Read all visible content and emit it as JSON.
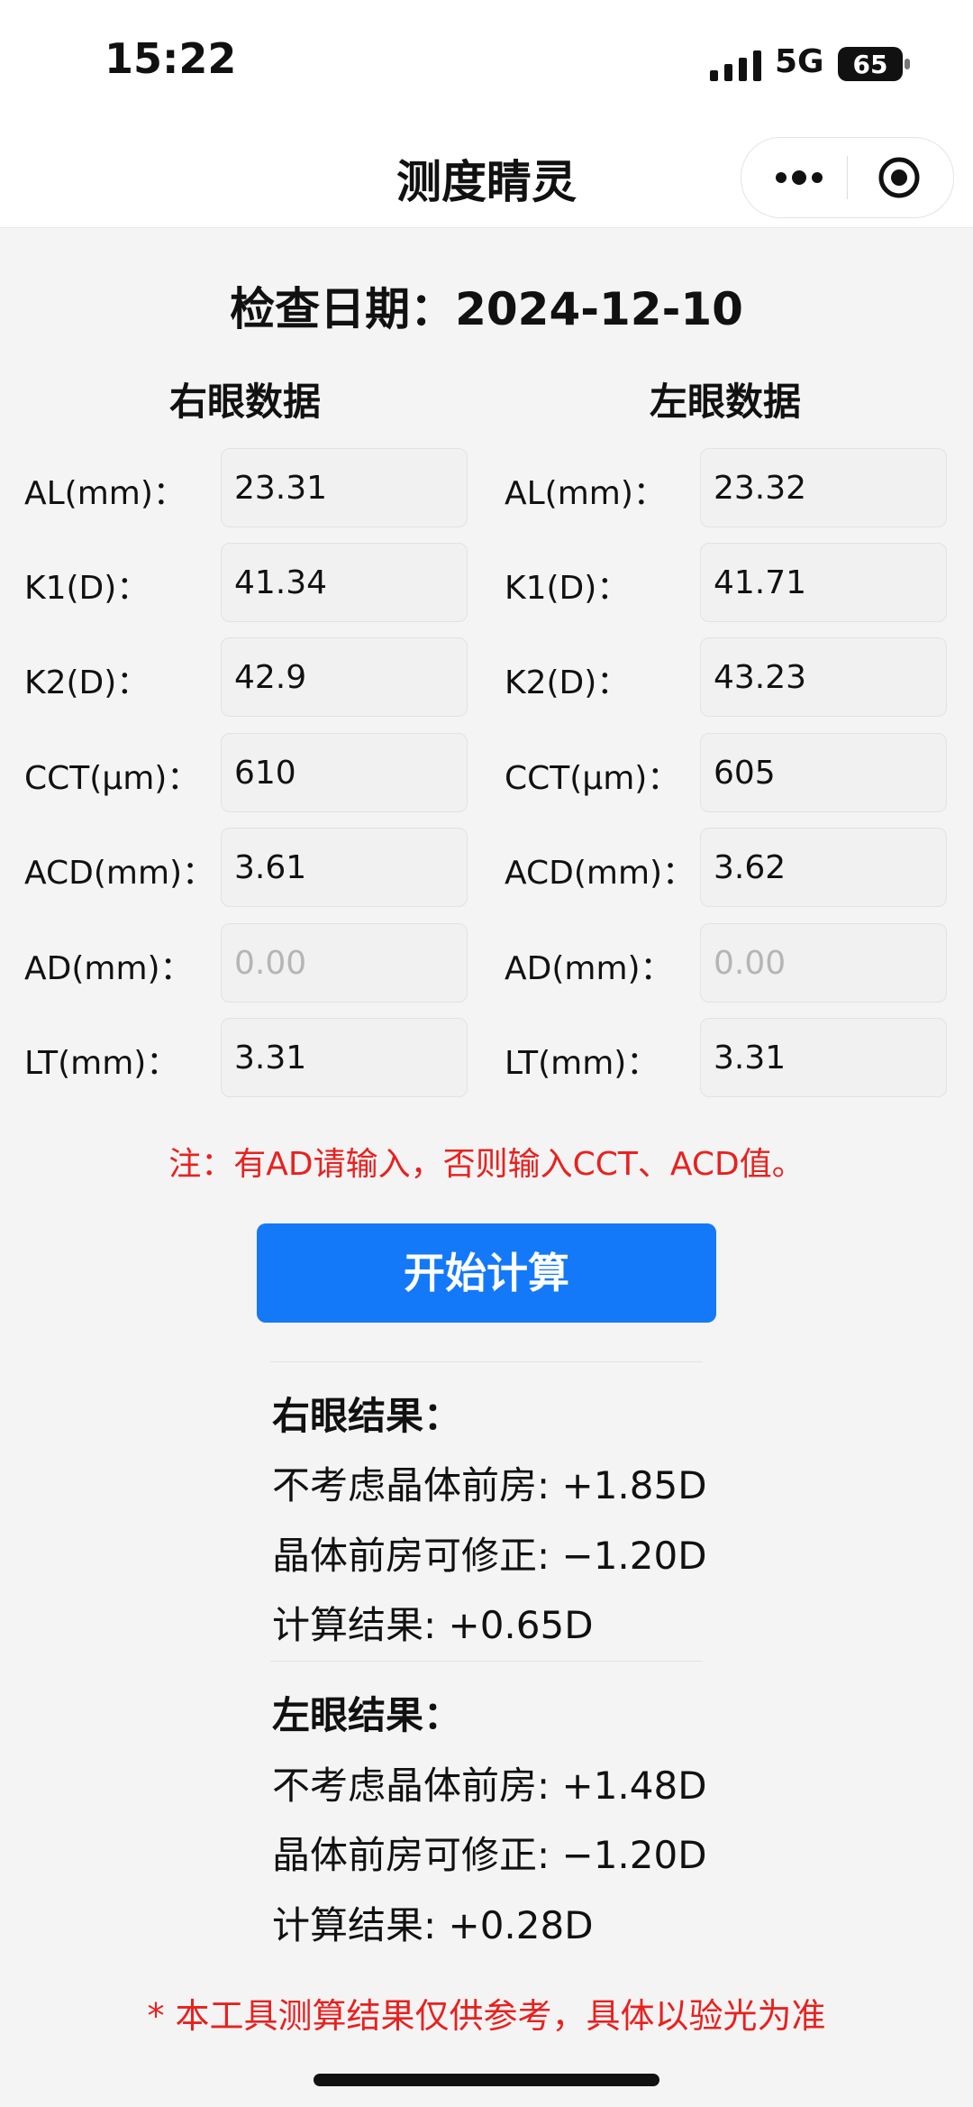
{
  "status_bar": {
    "time": "15:22",
    "network": "5G",
    "battery": "65"
  },
  "nav": {
    "title": "测度睛灵",
    "icons": [
      "more-icon",
      "target-icon"
    ]
  },
  "exam_date": "检查日期：2024-12-10",
  "right_eye": {
    "heading": "右眼数据",
    "fields": [
      {
        "label": "AL(mm)：",
        "value": "23.31",
        "placeholder": ""
      },
      {
        "label": "K1(D)：",
        "value": "41.34",
        "placeholder": ""
      },
      {
        "label": "K2(D)：",
        "value": "42.9",
        "placeholder": ""
      },
      {
        "label": "CCT(μm)：",
        "value": "610",
        "placeholder": ""
      },
      {
        "label": "ACD(mm)：",
        "value": "3.61",
        "placeholder": ""
      },
      {
        "label": "AD(mm)：",
        "value": "",
        "placeholder": "0.00"
      },
      {
        "label": "LT(mm)：",
        "value": "3.31",
        "placeholder": ""
      }
    ]
  },
  "left_eye": {
    "heading": "左眼数据",
    "fields": [
      {
        "label": "AL(mm)：",
        "value": "23.32",
        "placeholder": ""
      },
      {
        "label": "K1(D)：",
        "value": "41.71",
        "placeholder": ""
      },
      {
        "label": "K2(D)：",
        "value": "43.23",
        "placeholder": ""
      },
      {
        "label": "CCT(μm)：",
        "value": "605",
        "placeholder": ""
      },
      {
        "label": "ACD(mm)：",
        "value": "3.62",
        "placeholder": ""
      },
      {
        "label": "AD(mm)：",
        "value": "",
        "placeholder": "0.00"
      },
      {
        "label": "LT(mm)：",
        "value": "3.31",
        "placeholder": ""
      }
    ]
  },
  "note": "注：有AD请输入，否则输入CCT、ACD值。",
  "button_label": "开始计算",
  "results": {
    "right": {
      "title": "右眼结果：",
      "lines": [
        "不考虑晶体前房: +1.85D",
        "晶体前房可修正: −1.20D",
        "计算结果: +0.65D"
      ]
    },
    "left": {
      "title": "左眼结果：",
      "lines": [
        "不考虑晶体前房: +1.48D",
        "晶体前房可修正: −1.20D",
        "计算结果: +0.28D"
      ]
    }
  },
  "footer": "* 本工具测算结果仅供参考，具体以验光为准",
  "colors": {
    "accent": "#1479f8",
    "warning": "#e8211f",
    "page_bg": "#f4f4f4"
  }
}
